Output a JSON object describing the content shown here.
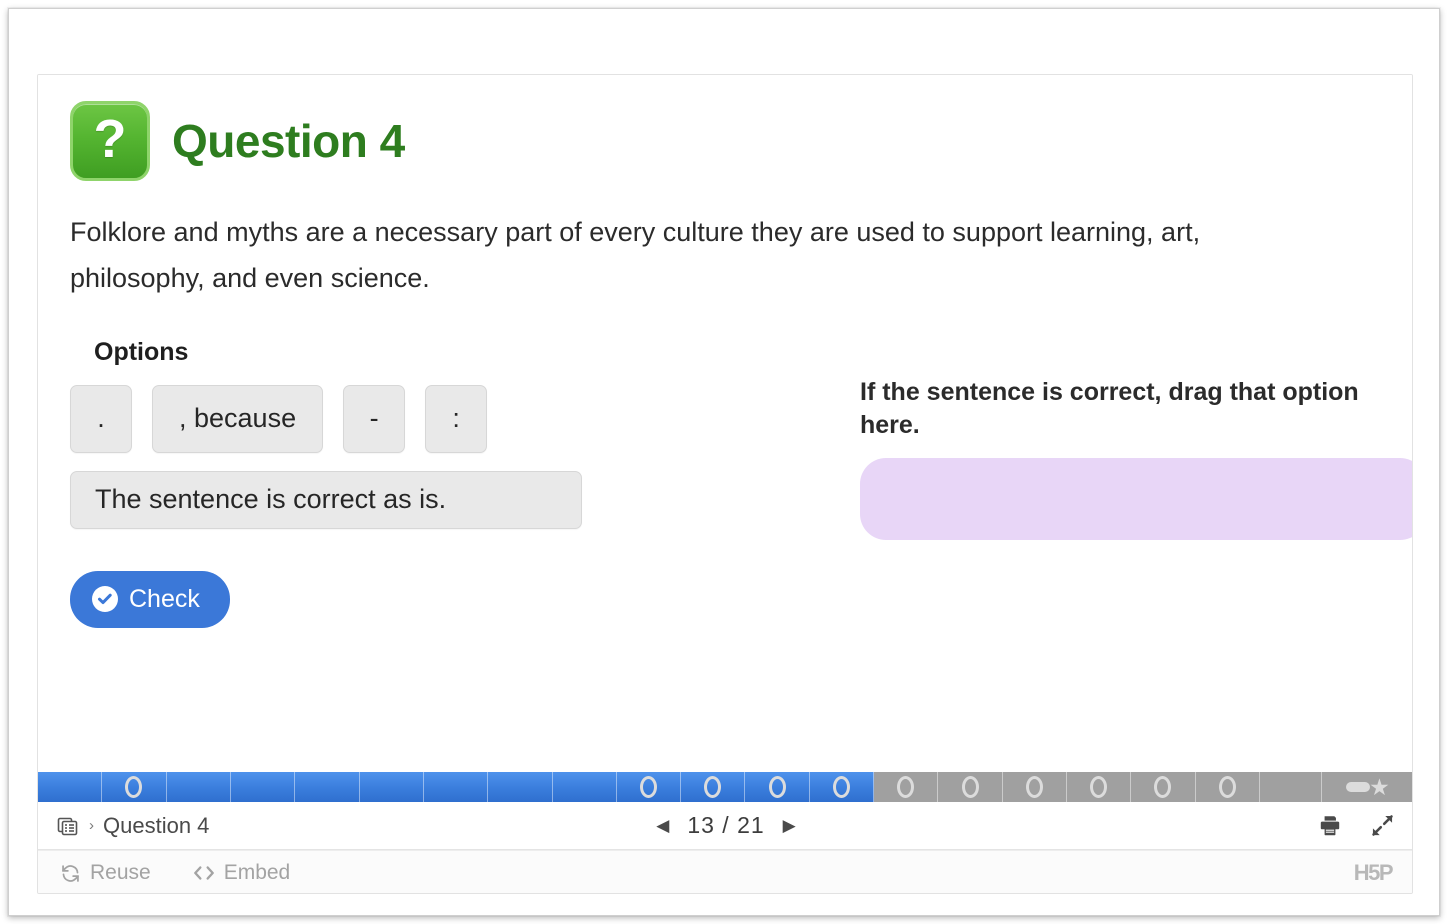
{
  "question": {
    "icon_name": "question-mark-icon",
    "title": "Question 4",
    "statement": "Folklore and myths are a necessary part of every culture they are used to support learning, art, philosophy, and even science.",
    "accent_color": "#2e7d1f"
  },
  "options": {
    "label": "Options",
    "items": [
      {
        "text": ".",
        "size": "small"
      },
      {
        "text": ", because",
        "size": "wide"
      },
      {
        "text": "-",
        "size": "small"
      },
      {
        "text": ":",
        "size": "small"
      },
      {
        "text": "The sentence is correct as is.",
        "size": "full"
      }
    ]
  },
  "dropzone": {
    "title": "If the sentence is correct, drag that option here.",
    "color": "#e8d6f7",
    "content": ""
  },
  "actions": {
    "check_label": "Check",
    "check_icon": "check-circle-icon",
    "check_color": "#3b78d8"
  },
  "progress": {
    "total_segments": 20,
    "completed_segments": 13,
    "marker_segments": [
      1,
      10,
      11,
      12,
      13
    ],
    "summary_icon": "summary-star-icon",
    "done_color": "#3a7ddc",
    "todo_color": "#a0a0a0"
  },
  "navigation": {
    "slides_icon": "slides-list-icon",
    "separator": "›",
    "breadcrumb": "Question 4",
    "prev_icon": "◀",
    "next_icon": "▶",
    "current_page": "13",
    "page_separator": "/",
    "total_pages": "21",
    "page_display": "13 / 21",
    "print_icon": "printer-icon",
    "fullscreen_icon": "fullscreen-expand-icon"
  },
  "footer": {
    "reuse_label": "Reuse",
    "reuse_icon": "refresh-icon",
    "embed_label": "Embed",
    "embed_icon": "code-brackets-icon",
    "logo_text": "H5P"
  }
}
